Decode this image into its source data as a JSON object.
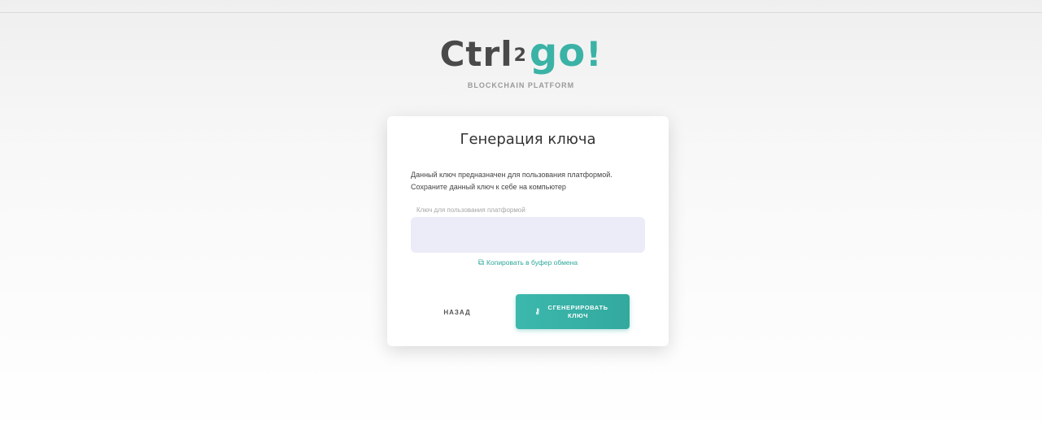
{
  "logo": {
    "part1": "Ctrl",
    "superscript": "2",
    "part2": "go",
    "exclaim": "!",
    "tagline": "BLOCKCHAIN PLATFORM"
  },
  "card": {
    "title": "Генерация ключа",
    "description": "Данный ключ предназначен для пользования платформой. Сохраните данный ключ к себе на компьютер",
    "field_label": "Ключ для пользования платформой",
    "field_value": "",
    "field_placeholder": "",
    "copy_icon": "copy-icon",
    "copy_label": "Копировать в буфер обмена",
    "back_label": "НАЗАД",
    "generate_icon": "key-icon",
    "generate_label": "СГЕНЕРИРОВАТЬ КЛЮЧ"
  },
  "colors": {
    "accent": "#3bb2a6",
    "logo_dark": "#4a4a4a",
    "field_bg": "#ececf8"
  }
}
